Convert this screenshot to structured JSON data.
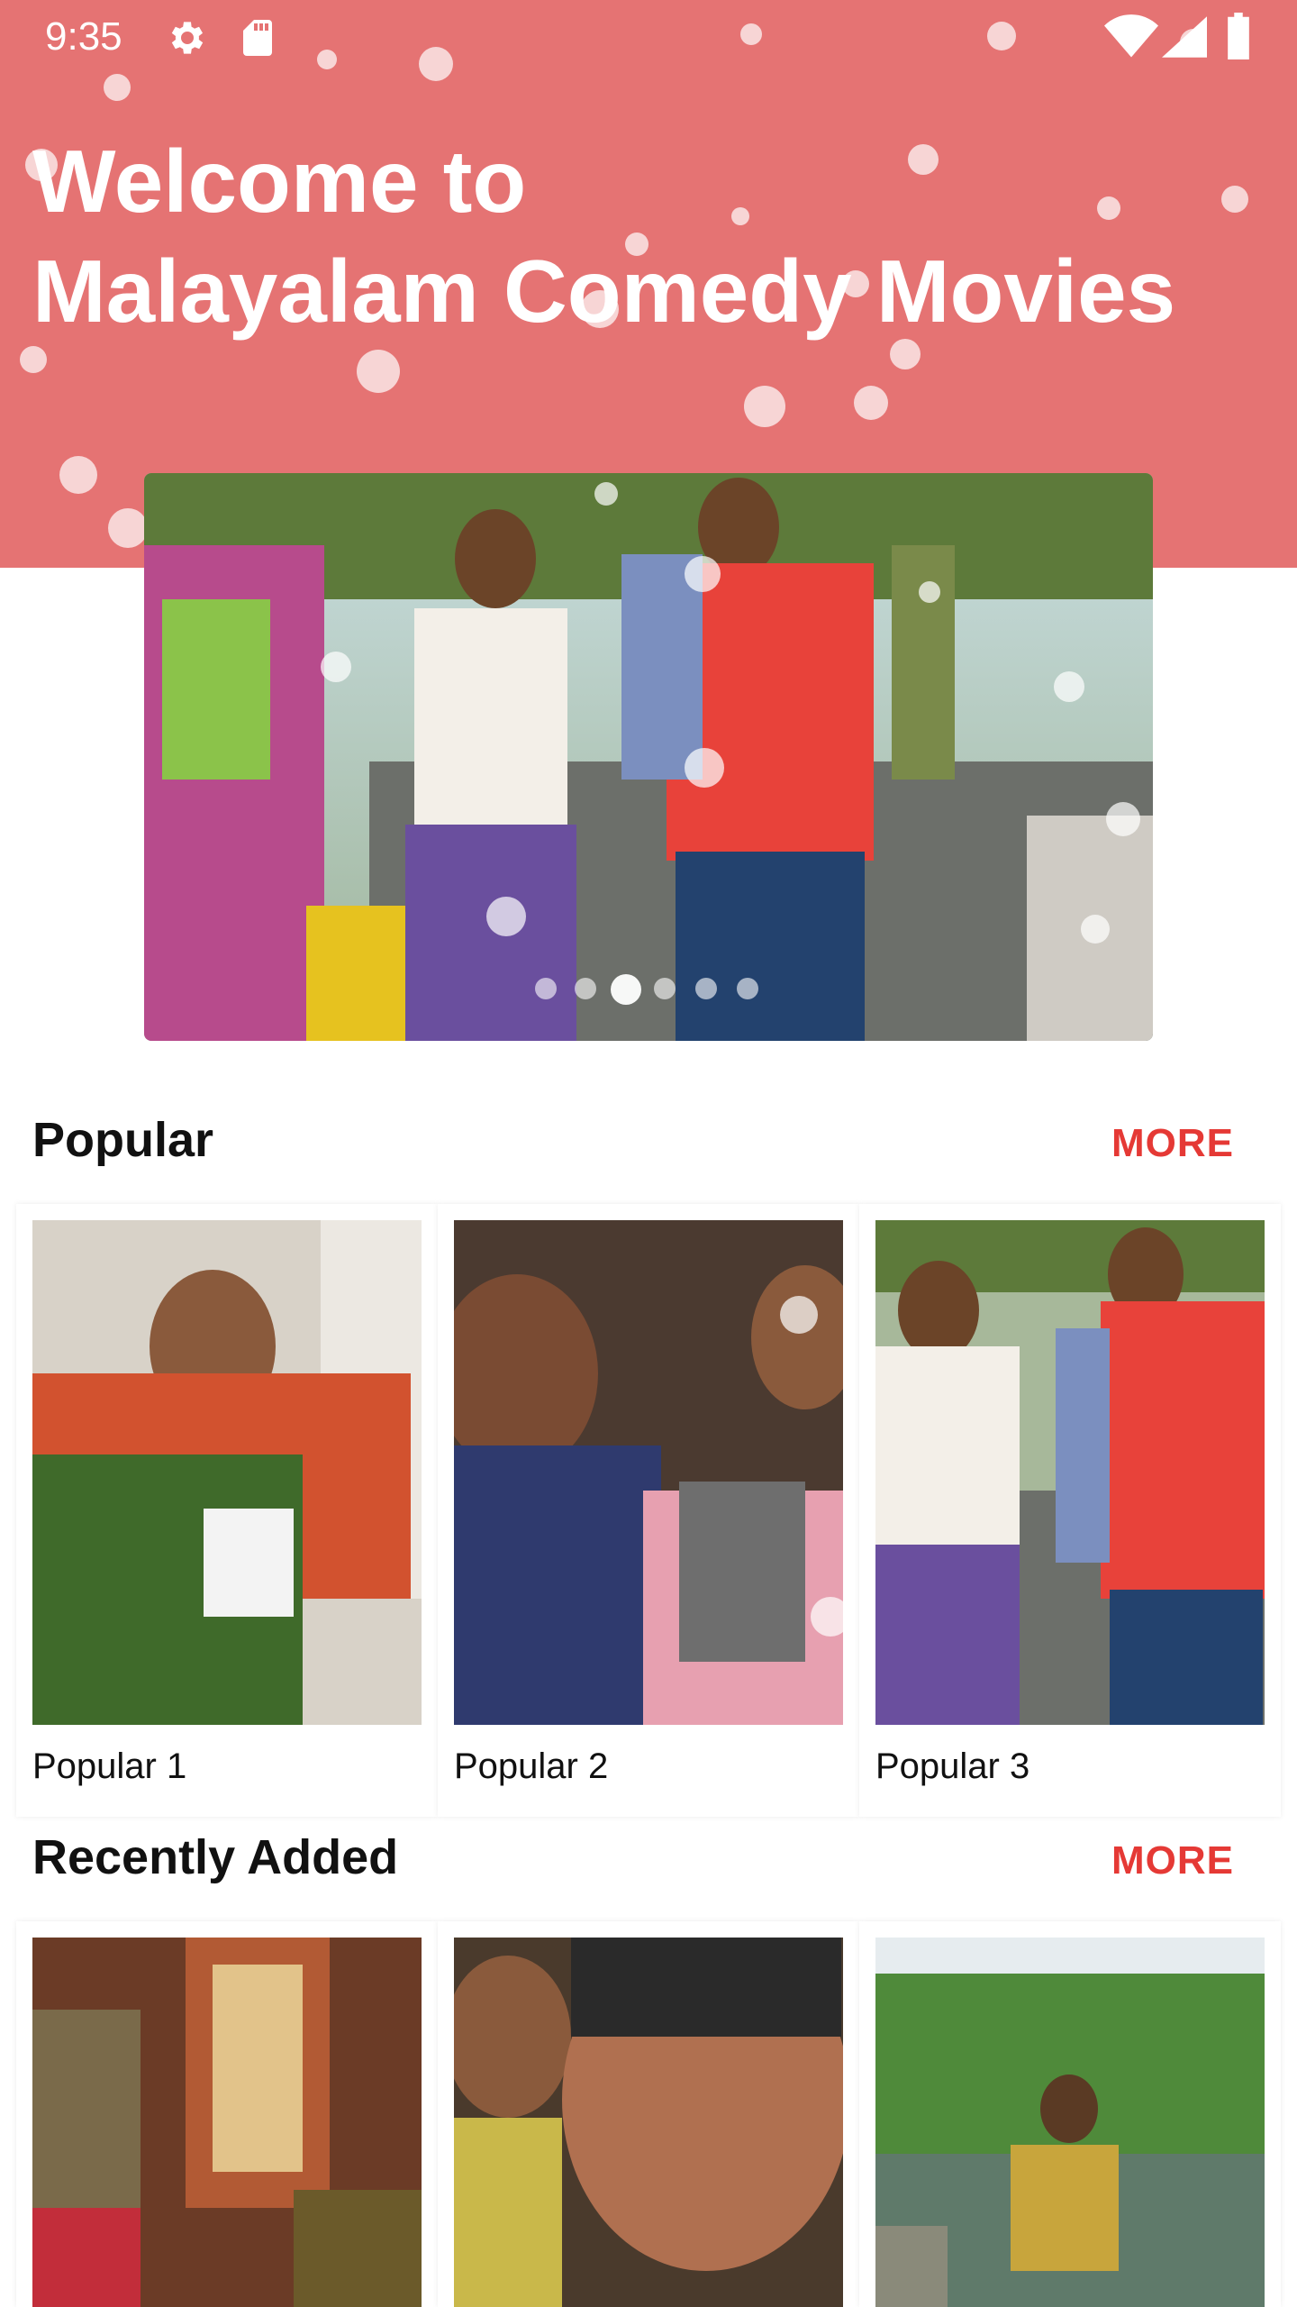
{
  "status_bar": {
    "time": "9:35",
    "icons": [
      "settings-icon",
      "sd-card-icon",
      "wifi-icon",
      "signal-icon",
      "battery-icon"
    ]
  },
  "header": {
    "line1": "Welcome to",
    "line2": "Malayalam Comedy Movies",
    "background": "#e57373"
  },
  "hero": {
    "image": "hero-movie-scene"
  },
  "popular": {
    "title": "Popular",
    "more_label": "MORE",
    "items": [
      {
        "label": "Popular 1"
      },
      {
        "label": "Popular 2"
      },
      {
        "label": "Popular 3"
      }
    ]
  },
  "recent": {
    "title": "Recently Added",
    "more_label": "MORE"
  },
  "colors": {
    "accent": "#e53935",
    "header_bg": "#e57373"
  }
}
